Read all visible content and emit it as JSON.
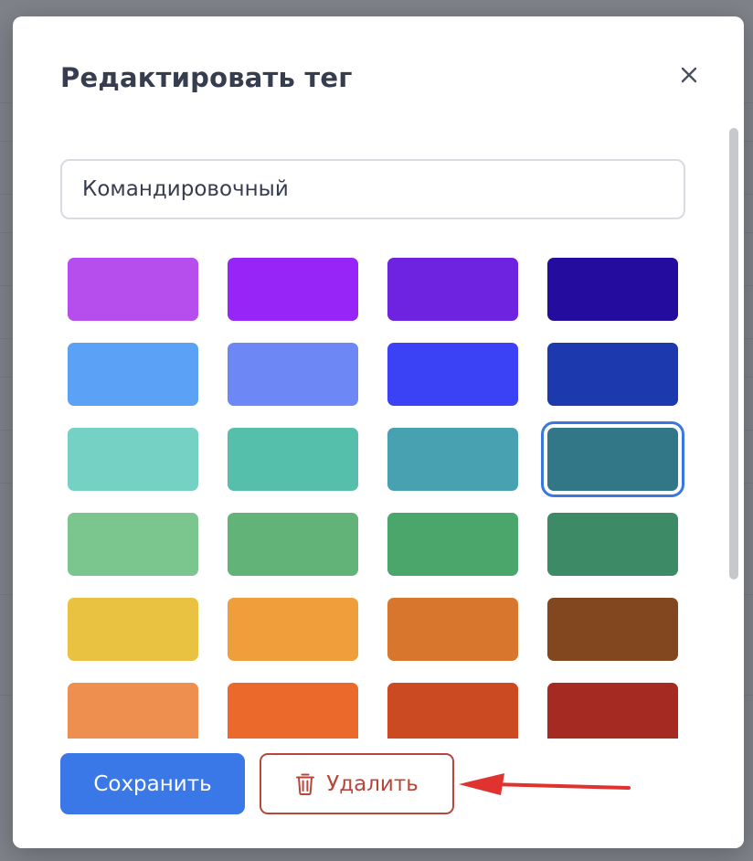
{
  "modal": {
    "title": "Редактировать тег",
    "close_icon": "close-icon"
  },
  "name_field": {
    "value": "Командировочный"
  },
  "swatches": {
    "colors": [
      "#b64eed",
      "#9725f7",
      "#6e23e0",
      "#230c9e",
      "#5ba1f5",
      "#6d88f5",
      "#3b42f5",
      "#1c3aae",
      "#74d1c3",
      "#56bfab",
      "#48a1b1",
      "#327788",
      "#7bc58f",
      "#62b378",
      "#4ba66b",
      "#3d8a67",
      "#e8c240",
      "#f09e3c",
      "#d9762d",
      "#834720",
      "#ef8f4f",
      "#eb6a2b",
      "#cb4a22",
      "#a42a22"
    ],
    "selected_index": 11
  },
  "footer": {
    "save_label": "Сохранить",
    "delete_label": "Удалить",
    "delete_icon": "trash-icon"
  },
  "annotation": {
    "arrow_color": "#e0322e"
  },
  "accent_color": "#3b78e7",
  "danger_color": "#b8473a"
}
